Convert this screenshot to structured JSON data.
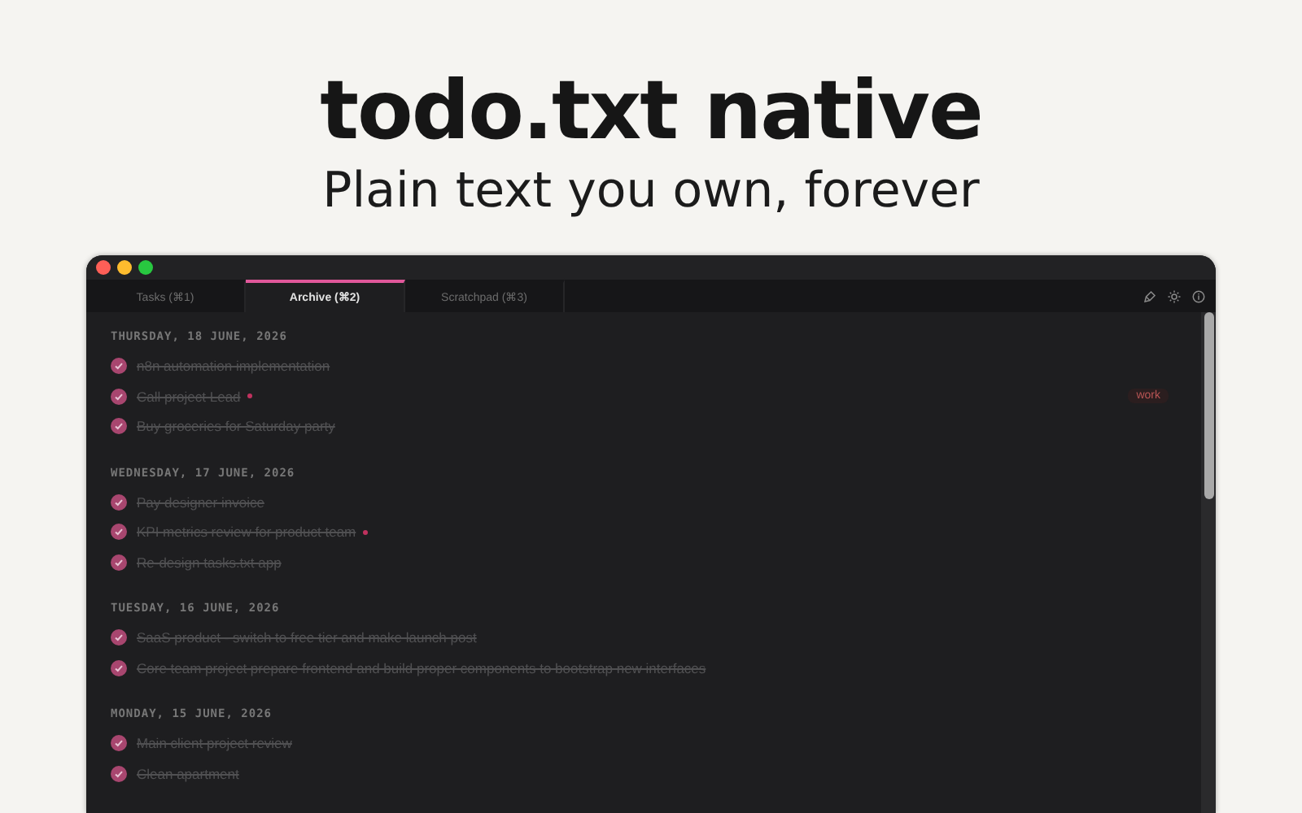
{
  "hero": {
    "title": "todo.txt native",
    "subtitle": "Plain text you own, forever"
  },
  "tabs": [
    {
      "label": "Tasks (⌘1)",
      "selected": false
    },
    {
      "label": "Archive (⌘2)",
      "selected": true
    },
    {
      "label": "Scratchpad (⌘3)",
      "selected": false
    }
  ],
  "groups": [
    {
      "date": "THURSDAY, 18 JUNE, 2026",
      "tasks": [
        {
          "text": "n8n automation implementation",
          "done": true,
          "flagged": false
        },
        {
          "text": "Call project Lead",
          "done": true,
          "flagged": true,
          "tag": "work"
        },
        {
          "text": "Buy groceries for Saturday party",
          "done": true,
          "flagged": false
        }
      ]
    },
    {
      "date": "WEDNESDAY, 17 JUNE, 2026",
      "tasks": [
        {
          "text": "Pay designer invoice",
          "done": true,
          "flagged": false
        },
        {
          "text": "KPI metrics review for product team",
          "done": true,
          "flagged": true
        },
        {
          "text": "Re-design tasks.txt app",
          "done": true,
          "flagged": false
        }
      ]
    },
    {
      "date": "TUESDAY, 16 JUNE, 2026",
      "tasks": [
        {
          "text": "SaaS product - switch to free tier and make launch post",
          "done": true,
          "flagged": false
        },
        {
          "text": "Core team project prepare frontend and build proper components to bootstrap new interfaces",
          "done": true,
          "flagged": false
        }
      ]
    },
    {
      "date": "MONDAY, 15 JUNE, 2026",
      "tasks": [
        {
          "text": "Main client project review",
          "done": true,
          "flagged": false
        },
        {
          "text": "Clean apartment",
          "done": true,
          "flagged": false
        }
      ]
    }
  ]
}
